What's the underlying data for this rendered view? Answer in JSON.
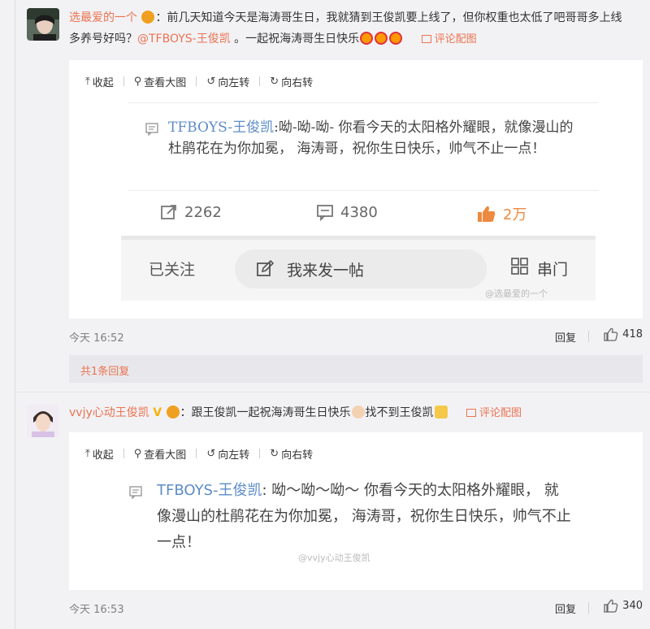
{
  "comment1": {
    "username": "选最爱的一个",
    "text": "：前几天知道今天是海涛哥生日，我就猜到王俊凯要上线了，但你权重也太低了吧哥哥多上线多养号好吗？",
    "mention": "@TFBOYS-王俊凯",
    "text_tail": " 。一起祝海涛哥生日快乐",
    "pic_link": "评论配图",
    "toolbar": [
      "收起",
      "查看大图",
      "向左转",
      "向右转"
    ],
    "shot": {
      "author": "TFBOYS-王俊凯",
      "body": ":呦-呦-呦- 你看今天的太阳格外耀眼，就像漫山的杜鹃花在为你加冕， 海涛哥，祝你生日快乐，帅气不止一点！",
      "repost_count": "2262",
      "comment_count": "4380",
      "like_count": "2万",
      "follow_label": "已关注",
      "post_label": "我来发一帖",
      "menu_label": "串门",
      "watermark": "@选最爱的一个"
    },
    "time": "今天 16:52",
    "reply_label": "回复",
    "likes": "418"
  },
  "reply_summary": "共1条回复",
  "comment2": {
    "username": "vvjy心动王俊凯",
    "text": "：跟王俊凯一起祝海涛哥生日快乐",
    "text_tail": "找不到王俊凯",
    "pic_link": "评论配图",
    "toolbar": [
      "收起",
      "查看大图",
      "向左转",
      "向右转"
    ],
    "shot": {
      "author": "TFBOYS-王俊凯",
      "body": ": 呦～呦～呦～ 你看今天的太阳格外耀眼， 就像漫山的杜鹃花在为你加冕， 海涛哥，祝你生日快乐，帅气不止一点！",
      "watermark": "@vvjy心动王俊凯"
    },
    "time": "今天 16:53",
    "reply_label": "回复",
    "likes": "340"
  },
  "colors": {
    "accent": "#eb7350",
    "link_blue": "#5d8cc8",
    "like_orange": "#ee8a40"
  },
  "icons": [
    "collapse-icon",
    "magnifier-icon",
    "rotate-left-icon",
    "rotate-right-icon",
    "comment-icon",
    "repost-icon",
    "thumbs-up-icon",
    "edit-icon",
    "grid-icon"
  ]
}
